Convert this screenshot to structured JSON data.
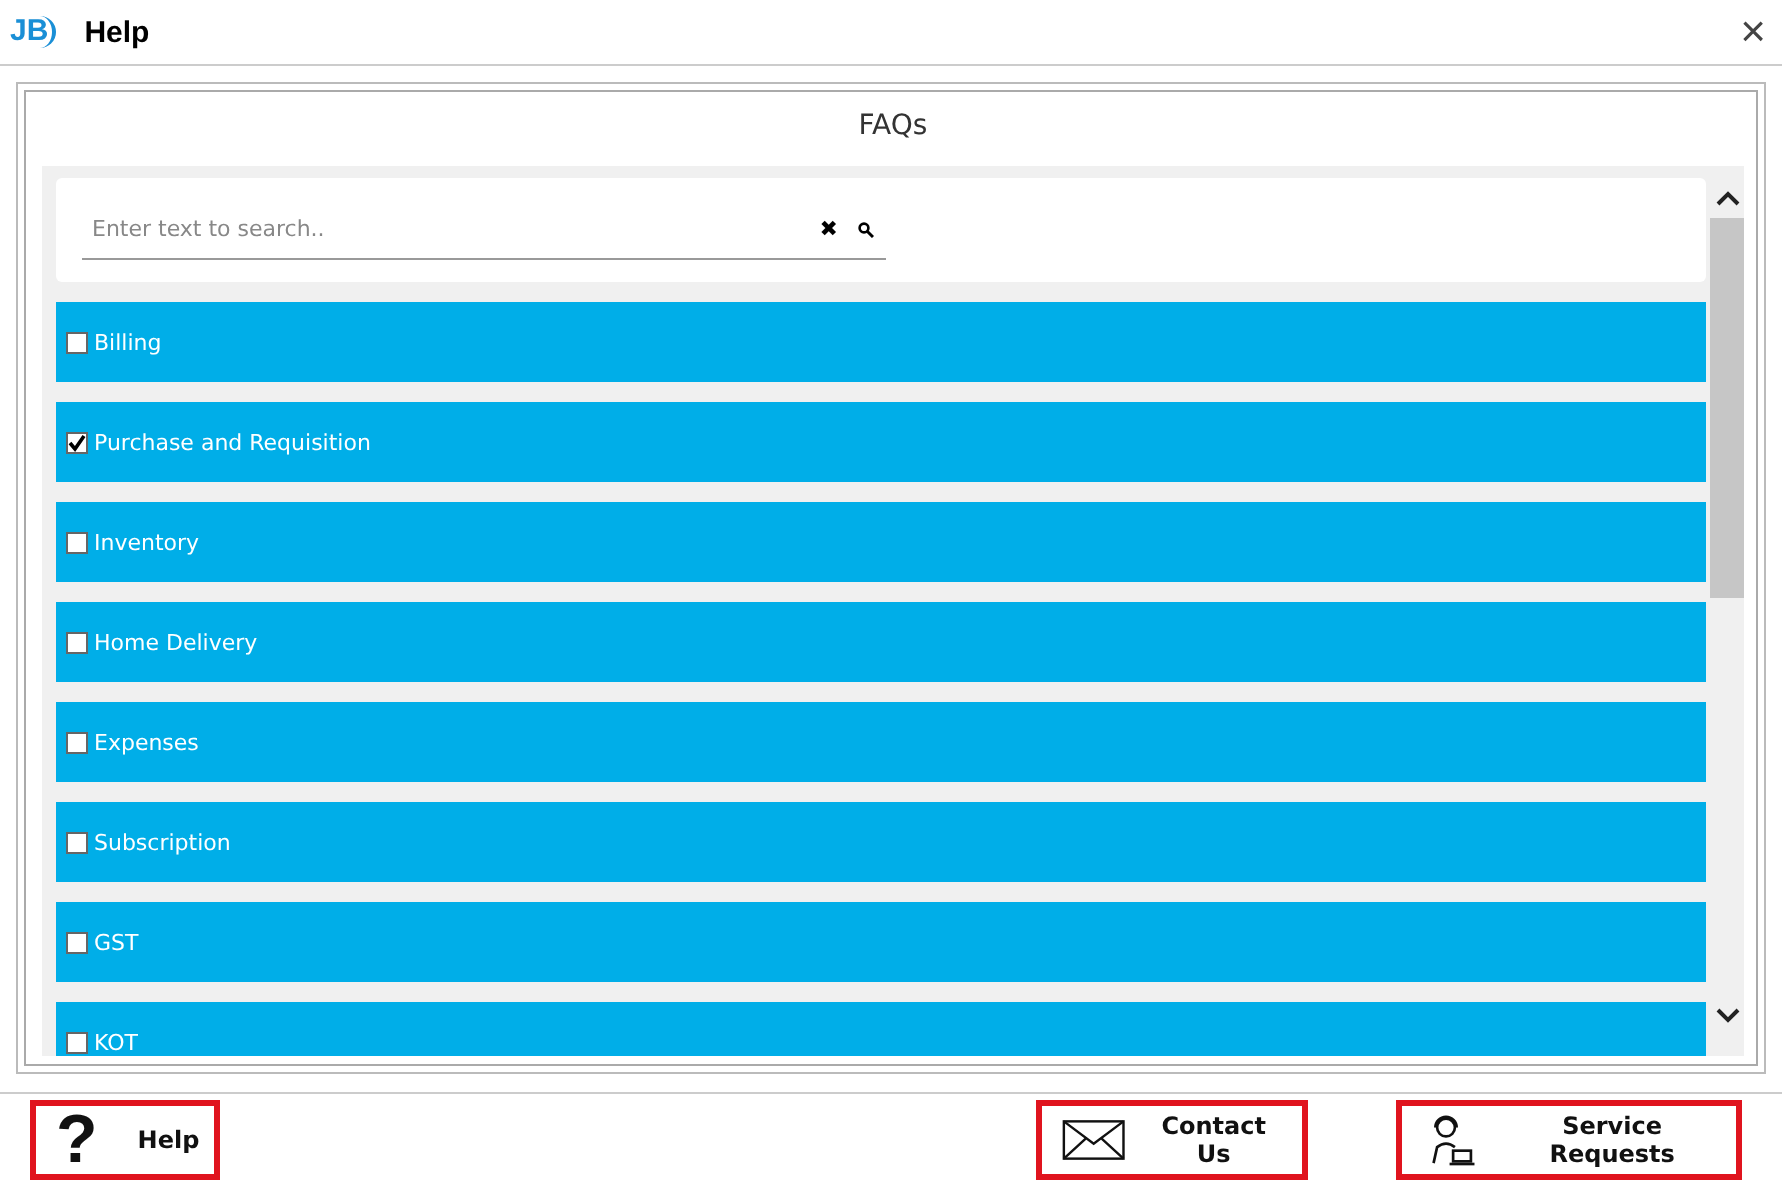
{
  "window": {
    "logo": "JB",
    "title": "Help",
    "close": "×"
  },
  "panel": {
    "title": "FAQs"
  },
  "search": {
    "placeholder": "Enter text to search..",
    "clear": "✖"
  },
  "categories": [
    {
      "label": "Billing",
      "checked": false
    },
    {
      "label": "Purchase and Requisition",
      "checked": true
    },
    {
      "label": "Inventory",
      "checked": false
    },
    {
      "label": "Home Delivery",
      "checked": false
    },
    {
      "label": "Expenses",
      "checked": false
    },
    {
      "label": "Subscription",
      "checked": false
    },
    {
      "label": "GST",
      "checked": false
    },
    {
      "label": "KOT",
      "checked": false
    }
  ],
  "footer": [
    {
      "kind": "help",
      "label": "Help",
      "glyph": "?"
    },
    {
      "kind": "contact",
      "label": "Contact Us"
    },
    {
      "kind": "service",
      "label": "Service Requests"
    }
  ]
}
